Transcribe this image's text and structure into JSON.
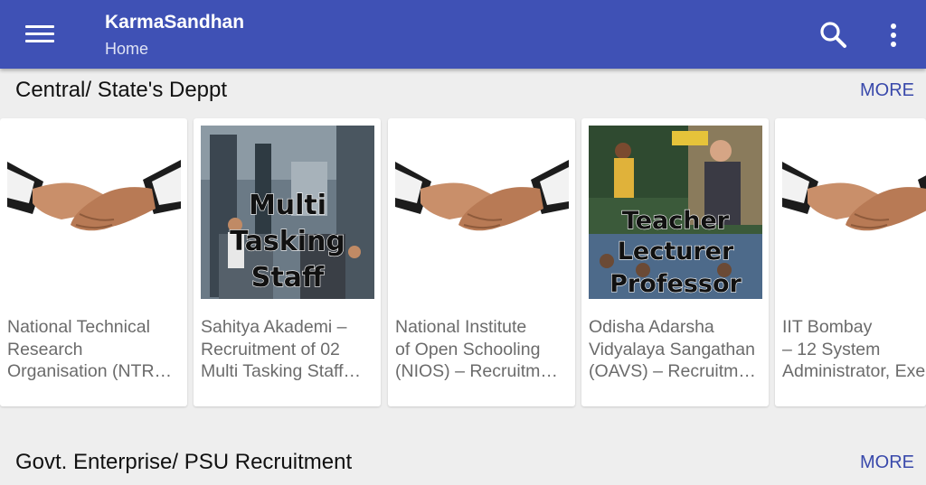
{
  "appbar": {
    "title": "KarmaSandhan",
    "subtitle": "Home",
    "menu_icon": "hamburger-menu-icon",
    "search_icon": "search-icon",
    "overflow_icon": "more-vert-icon",
    "color": "#3f51b5"
  },
  "sections": [
    {
      "title": "Central/ State's Deppt",
      "more_label": "MORE",
      "cards": [
        {
          "text": "National Technical\nResearch\nOrganisation (NTR…",
          "image": "handshake"
        },
        {
          "text": "Sahitya Akademi –\nRecruitment of 02\nMulti Tasking Staff…",
          "image": "multi-tasking-staff",
          "image_caption": [
            "Multi",
            "Tasking",
            "Staff"
          ]
        },
        {
          "text": "National Institute\nof Open Schooling\n(NIOS) – Recruitm…",
          "image": "handshake"
        },
        {
          "text": "Odisha Adarsha\nVidyalaya Sangathan\n(OAVS) – Recruitm…",
          "image": "teacher-lecturer-professor",
          "image_caption": [
            "Teacher",
            "Lecturer",
            "Professor"
          ]
        },
        {
          "text": "IIT Bombay\n– 12 System\nAdministrator, Exe",
          "image": "handshake"
        }
      ]
    },
    {
      "title": "Govt. Enterprise/ PSU Recruitment",
      "more_label": "MORE"
    }
  ]
}
